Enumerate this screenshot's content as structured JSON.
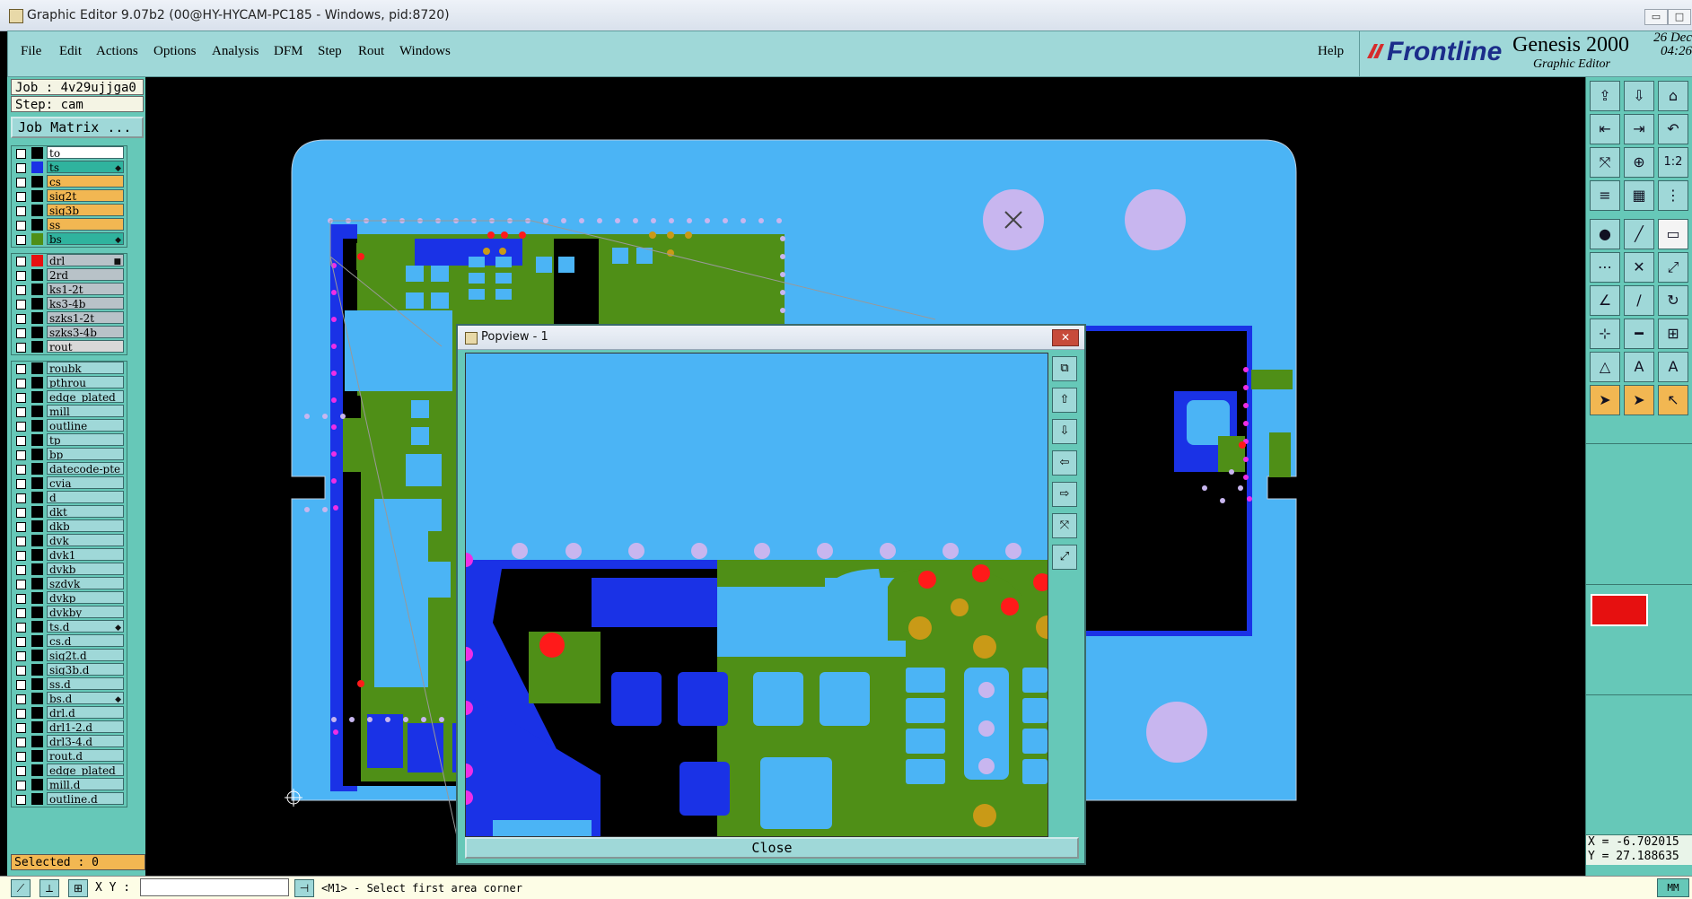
{
  "window": {
    "title": "Graphic Editor 9.07b2 (00@HY-HYCAM-PC185 - Windows, pid:8720)"
  },
  "menu": {
    "items": [
      "File",
      "Edit",
      "Actions",
      "Options",
      "Analysis",
      "DFM",
      "Step",
      "Rout",
      "Windows"
    ],
    "help": "Help"
  },
  "brand": {
    "logo": "Frontline",
    "product": "Genesis 2000",
    "subtitle": "Graphic Editor",
    "date": "26 Dec",
    "time": "04:26"
  },
  "job": {
    "job_label": "Job : 4v29ujjga0",
    "step_label": "Step: cam",
    "matrix_button": "Job Matrix ..."
  },
  "layers_board": [
    {
      "name": "to",
      "color": "#000000",
      "bg": "#ffffff"
    },
    {
      "name": "ts",
      "color": "#1a32e6",
      "bg": "#2fb39e",
      "flag": "◆"
    },
    {
      "name": "cs",
      "color": "#000000",
      "bg": "#f2b752"
    },
    {
      "name": "sig2t",
      "color": "#000000",
      "bg": "#f2b752"
    },
    {
      "name": "sig3b",
      "color": "#000000",
      "bg": "#f2b752"
    },
    {
      "name": "ss",
      "color": "#000000",
      "bg": "#f2b752"
    },
    {
      "name": "bs",
      "color": "#4f8f17",
      "bg": "#2fb39e",
      "flag": "◆"
    }
  ],
  "layers_drill": [
    {
      "name": "drl",
      "color": "#e61010",
      "bg": "#b8c2c8",
      "flag": "■"
    },
    {
      "name": "2rd",
      "color": "#000000",
      "bg": "#b8c2c8"
    },
    {
      "name": "ks1-2t",
      "color": "#000000",
      "bg": "#b8c2c8"
    },
    {
      "name": "ks3-4b",
      "color": "#000000",
      "bg": "#b8c2c8"
    },
    {
      "name": "szks1-2t",
      "color": "#000000",
      "bg": "#b8c2c8"
    },
    {
      "name": "szks3-4b",
      "color": "#000000",
      "bg": "#b8c2c8"
    },
    {
      "name": "rout",
      "color": "#000000",
      "bg": "#d8d8d8"
    }
  ],
  "layers_misc": [
    {
      "name": "roubk"
    },
    {
      "name": "pthrou"
    },
    {
      "name": "edge_plated"
    },
    {
      "name": "mill"
    },
    {
      "name": "outline"
    },
    {
      "name": "tp"
    },
    {
      "name": "bp"
    },
    {
      "name": "datecode-pte"
    },
    {
      "name": "cvia"
    },
    {
      "name": "d"
    },
    {
      "name": "dkt"
    },
    {
      "name": "dkb"
    },
    {
      "name": "dvk"
    },
    {
      "name": "dvk1"
    },
    {
      "name": "dvkb"
    },
    {
      "name": "szdvk"
    },
    {
      "name": "dvkp"
    },
    {
      "name": "dvkby"
    },
    {
      "name": "ts.d",
      "flag": "◆"
    },
    {
      "name": "cs.d"
    },
    {
      "name": "sig2t.d"
    },
    {
      "name": "sig3b.d"
    },
    {
      "name": "ss.d"
    },
    {
      "name": "bs.d",
      "flag": "◆"
    },
    {
      "name": "drl.d"
    },
    {
      "name": "drl1-2.d"
    },
    {
      "name": "drl3-4.d"
    },
    {
      "name": "rout.d"
    },
    {
      "name": "edge_plated"
    },
    {
      "name": "mill.d"
    },
    {
      "name": "outline.d"
    }
  ],
  "selected": "Selected : 0",
  "popview": {
    "title": "Popview - 1",
    "close": "Close"
  },
  "coords": {
    "x": "X = -6.702015",
    "y": "Y = 27.188635"
  },
  "status": {
    "xy_label": "X Y :",
    "xy_value": "",
    "prompt": "<M1> - Select first area corner",
    "units": "MM"
  },
  "tools": [
    "import-icon",
    "export-icon",
    "home-icon",
    "pan-left-icon",
    "pan-right-icon",
    "undo-view-icon",
    "zoom-fit-icon",
    "zoom-center-icon",
    "scale-1-2-icon",
    "measure-icon",
    "grid-icon",
    "snap-icon",
    "pad-icon",
    "line-draw-icon",
    "ruler-icon",
    "connect-icon",
    "cross-icon",
    "probe-icon",
    "edit-line-icon",
    "slash-icon",
    "arc-icon",
    "move-icon",
    "split-icon",
    "align-icon",
    "triangle-icon",
    "text-icon",
    "text-outline-icon",
    "select-icon",
    "select-move-icon",
    "select-arc-icon"
  ],
  "scale_label": "1:2",
  "colors": {
    "ui_bg": "#66c8b8",
    "menu_bg": "#9fd8d8",
    "board_light": "#4bb4f5",
    "board_dark": "#1a32e6",
    "copper": "#4f8f17",
    "hole": "#c8b6ef",
    "red_pad": "#ff1a1a",
    "gold_pad": "#c99a17",
    "magenta": "#ee2ee6"
  }
}
